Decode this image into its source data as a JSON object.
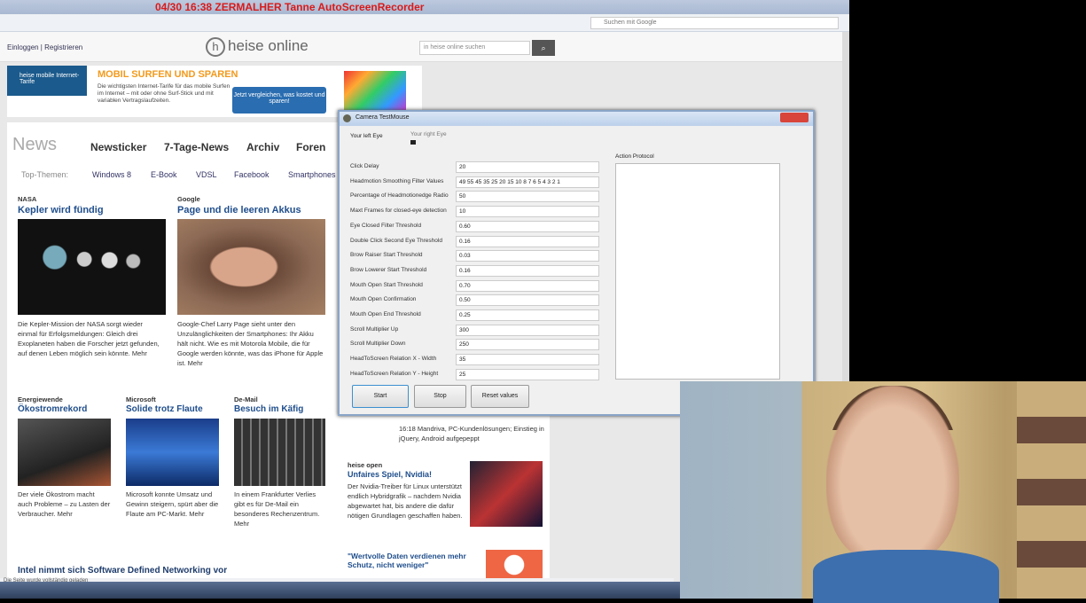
{
  "recorder_overlay": "04/30 16:38 ZERMALHER Tanne AutoScreenRecorder",
  "browser": {
    "google_search_placeholder": "Suchen mit Google"
  },
  "heise": {
    "login": "Einloggen | Registrieren",
    "logo": "heise online",
    "search_placeholder": "in heise online suchen",
    "search_icon": "magnifier-icon"
  },
  "ad": {
    "left": "heise mobile Internet-Tarife",
    "title": "MOBIL SURFEN UND SPAREN",
    "body": "Die wichtigsten Internet-Tarife für das mobile Surfen im Internet – mit oder ohne Surf-Stick und mit variablen Vertragslaufzeiten.",
    "button": "Jetzt vergleichen, was kostet und sparen!"
  },
  "news": {
    "title": "News",
    "nav": [
      "Newsticker",
      "7-Tage-News",
      "Archiv",
      "Foren"
    ],
    "sub": [
      "Top-Themen:",
      "Windows 8",
      "E-Book",
      "VDSL",
      "Facebook",
      "Smartphones"
    ],
    "items": [
      {
        "cat": "NASA",
        "headline": "Kepler wird fündig",
        "text": "Die Kepler-Mission der NASA sorgt wieder einmal für Erfolgsmeldungen: Gleich drei Exoplaneten haben die Forscher jetzt gefunden, auf denen Leben möglich sein könnte. Mehr"
      },
      {
        "cat": "Google",
        "headline": "Page und die leeren Akkus",
        "text": "Google-Chef Larry Page sieht unter den Unzulänglichkeiten der Smartphones: Ihr Akku hält nicht. Wie es mit Motorola Mobile, die für Google werden könnte, was das iPhone für Apple ist. Mehr"
      },
      {
        "cat": "Energiewende",
        "headline": "Ökostromrekord",
        "text": "Der viele Ökostrom macht auch Probleme – zu Lasten der Verbraucher. Mehr"
      },
      {
        "cat": "Microsoft",
        "headline": "Solide trotz Flaute",
        "text": "Microsoft konnte Umsatz und Gewinn steigern, spürt aber die Flaute am PC-Markt. Mehr"
      },
      {
        "cat": "De-Mail",
        "headline": "Besuch im Käfig",
        "text": "In einem Frankfurter Verlies gibt es für De-Mail ein besonderes Rechenzentrum. Mehr"
      },
      {
        "cat": "heise open",
        "headline": "Unfaires Spiel, Nvidia!",
        "text": "Der Nvidia-Treiber für Linux unterstützt endlich Hybridgrafik – nachdem Nvidia abgewartet hat, bis andere die dafür nötigen Grundlagen geschaffen haben."
      },
      {
        "cat": "",
        "headline": "\"Wertvolle Daten verdienen mehr Schutz, nicht weniger\"",
        "text": ""
      }
    ],
    "bottom_headline": "Intel nimmt sich Software Defined Networking vor",
    "mid_text": "16:18 Mandriva, PC-Kundenlösungen; Einstieg in jQuery, Android aufgepeppt"
  },
  "dialog": {
    "title": "Camera TestMouse",
    "left_eye": "Your left Eye",
    "right_eye": "Your right Eye",
    "protocol_label": "Action Protocol",
    "fields": [
      {
        "label": "Click Delay",
        "value": "20"
      },
      {
        "label": "Headmotion Smoothing Filter Values",
        "value": "49 55 45 35 25 20 15 10 8 7 6 5 4 3 2 1"
      },
      {
        "label": "Percentage of Headmotionedge Radio",
        "value": "50"
      },
      {
        "label": "Maxt Frames for closed-eye detection",
        "value": "10"
      },
      {
        "label": "Eye Closed Filter Threshold",
        "value": "0.60"
      },
      {
        "label": "Double Click Second Eye Threshold",
        "value": "0.16"
      },
      {
        "label": "Brow Raiser Start Threshold",
        "value": "0.03"
      },
      {
        "label": "Brow Lowerer Start Threshold",
        "value": "0.16"
      },
      {
        "label": "Mouth Open Start Threshold",
        "value": "0.70"
      },
      {
        "label": "Mouth Open Confirmation",
        "value": "0.50"
      },
      {
        "label": "Mouth Open End Threshold",
        "value": "0.25"
      },
      {
        "label": "Scroll Multiplier Up",
        "value": "300"
      },
      {
        "label": "Scroll Multiplier Down",
        "value": "250"
      },
      {
        "label": "HeadToScreen Relation X - Width",
        "value": "35"
      },
      {
        "label": "HeadToScreen Relation Y - Height",
        "value": "25"
      }
    ],
    "buttons": [
      "Start",
      "Stop",
      "Reset values"
    ]
  },
  "status_text": "Die Seite wurde vollständig geladen"
}
